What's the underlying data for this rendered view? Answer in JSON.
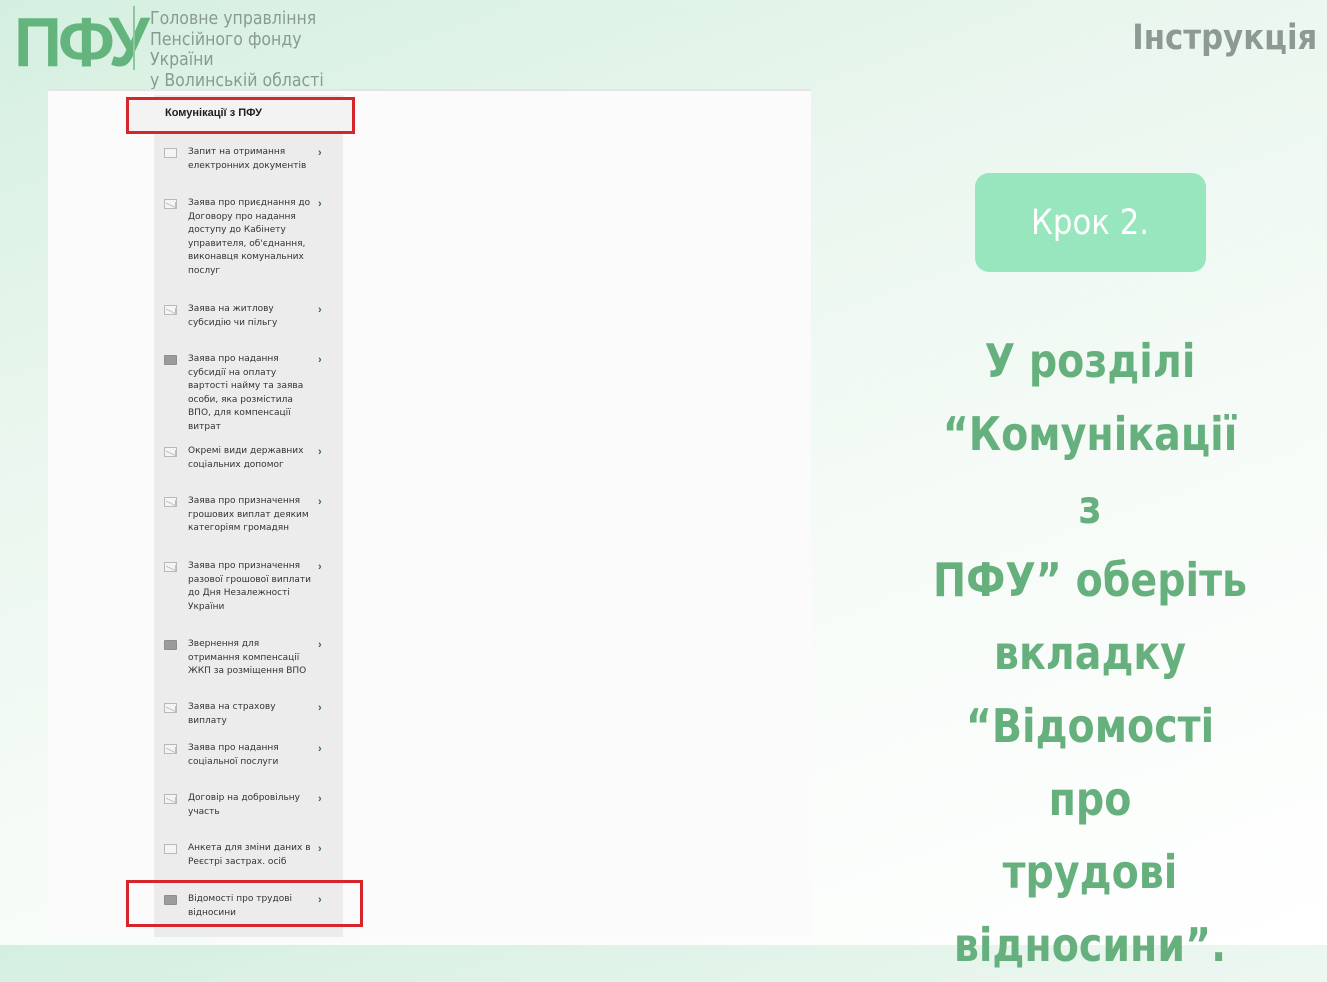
{
  "header": {
    "logo_mark": "ПФУ",
    "logo_lines": [
      "Головне управління",
      "Пенсійного фонду України",
      "у Волинській області"
    ],
    "instruction_label": "Інструкція"
  },
  "menu": {
    "title": "Комунікації з ПФУ",
    "items": [
      {
        "label": "Запит на отримання електронних документів",
        "icon": "document-icon"
      },
      {
        "label": "Заява про приєднання до Договору про надання доступу до Кабінету управителя, об'єднання, виконавця комунальних послуг",
        "icon": "envelope-icon"
      },
      {
        "label": "Заява на житлову субсидію чи пільгу",
        "icon": "envelope-icon"
      },
      {
        "label": "Заява про надання субсидії на оплату вартості найму та заява особи, яка розмістила ВПО, для компенсації витрат",
        "icon": "folder-icon"
      },
      {
        "label": "Окремі види державних соціальних допомог",
        "icon": "envelope-icon"
      },
      {
        "label": "Заява про призначення грошових виплат деяким категоріям громадян",
        "icon": "envelope-icon"
      },
      {
        "label": "Заява про призначення разової грошової виплати до Дня Незалежності України",
        "icon": "envelope-icon"
      },
      {
        "label": "Звернення для отримання компенсації ЖКП за розміщення ВПО",
        "icon": "folder-icon"
      },
      {
        "label": "Заява на страхову виплату",
        "icon": "envelope-icon"
      },
      {
        "label": "Заява про надання соціальної послуги",
        "icon": "envelope-icon"
      },
      {
        "label": "Договір на добровільну участь",
        "icon": "envelope-icon"
      },
      {
        "label": "Анкета для зміни даних в Реєстрі застрах. осіб",
        "icon": "document-icon"
      },
      {
        "label": "Відомості про трудові відносини",
        "icon": "folder-icon"
      }
    ],
    "chevron": "›",
    "highlight_color": "#d6252b"
  },
  "step": {
    "badge": "Крок 2.",
    "instruction_lines": [
      "У розділі",
      "“Комунікації з",
      "ПФУ” оберіть",
      "вкладку",
      "“Відомості про",
      "трудові",
      "відносини”."
    ]
  },
  "colors": {
    "brand_green": "#63b47d",
    "badge_bg": "#98e6be",
    "text_green": "#66b07e"
  }
}
